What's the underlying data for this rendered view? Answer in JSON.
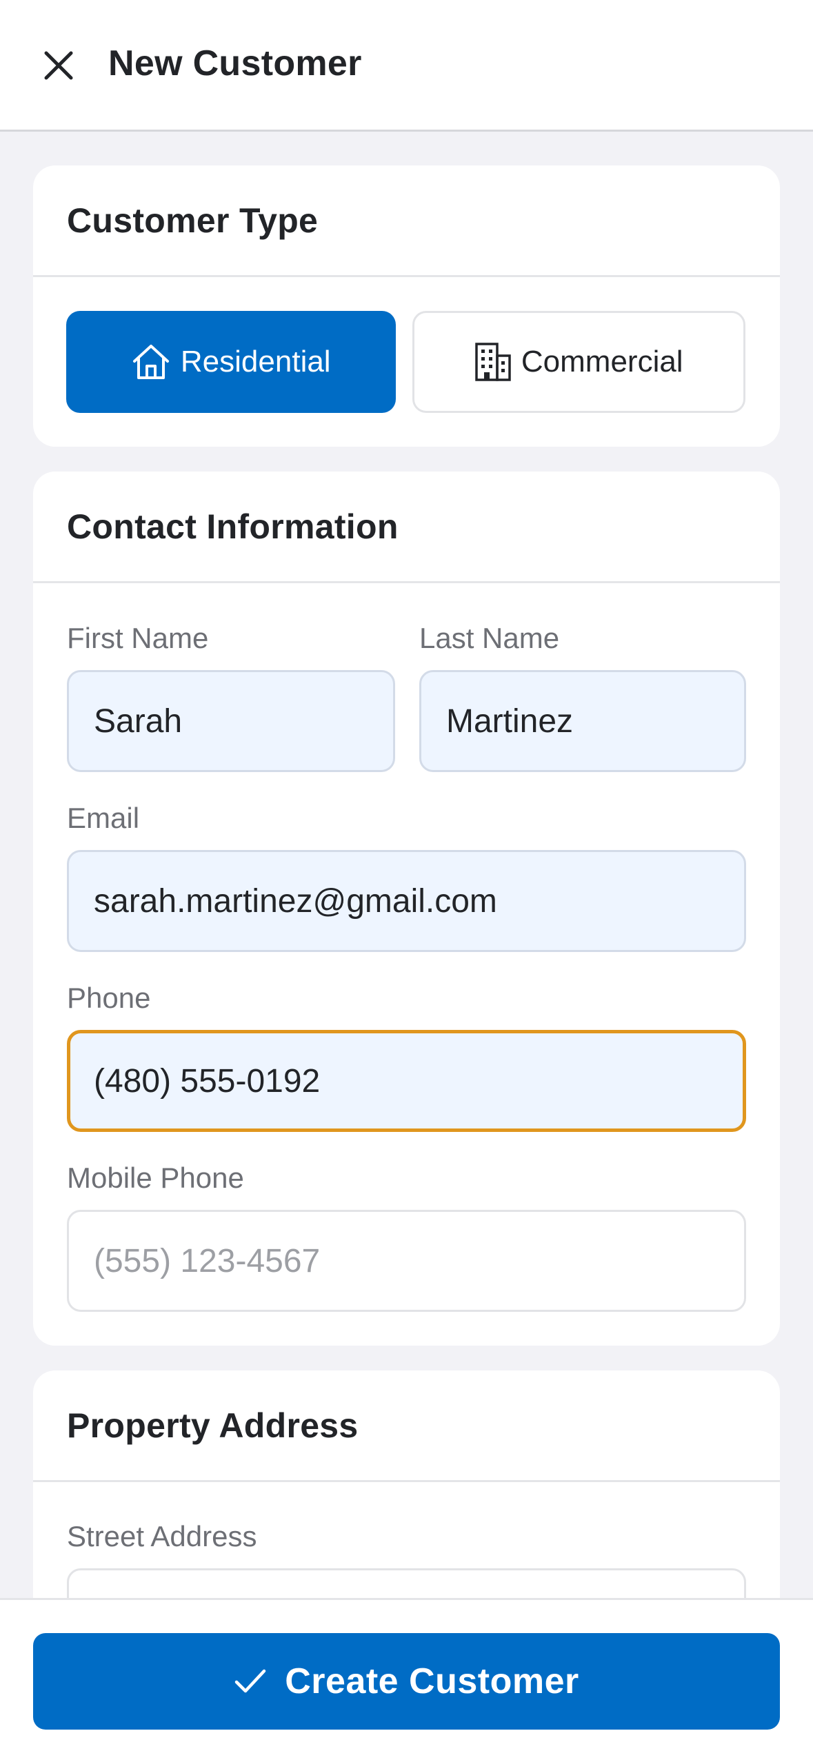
{
  "header": {
    "title": "New Customer",
    "close_icon": "close-icon"
  },
  "customer_type": {
    "title": "Customer Type",
    "options": [
      {
        "label": "Residential",
        "icon": "house-icon",
        "selected": true
      },
      {
        "label": "Commercial",
        "icon": "building-icon",
        "selected": false
      }
    ]
  },
  "contact": {
    "title": "Contact Information",
    "first_name": {
      "label": "First Name",
      "value": "Sarah"
    },
    "last_name": {
      "label": "Last Name",
      "value": "Martinez"
    },
    "email": {
      "label": "Email",
      "value": "sarah.martinez@gmail.com"
    },
    "phone": {
      "label": "Phone",
      "value": "(480) 555-0192"
    },
    "mobile_phone": {
      "label": "Mobile Phone",
      "value": "",
      "placeholder": "(555) 123-4567"
    }
  },
  "address": {
    "title": "Property Address",
    "street": {
      "label": "Street Address",
      "value": ""
    }
  },
  "footer": {
    "create_label": "Create Customer",
    "create_icon": "checkmark-icon"
  },
  "colors": {
    "primary": "#006cc5",
    "focus_border": "#e0961e",
    "input_fill": "#eef5ff",
    "background": "#f2f2f6"
  }
}
